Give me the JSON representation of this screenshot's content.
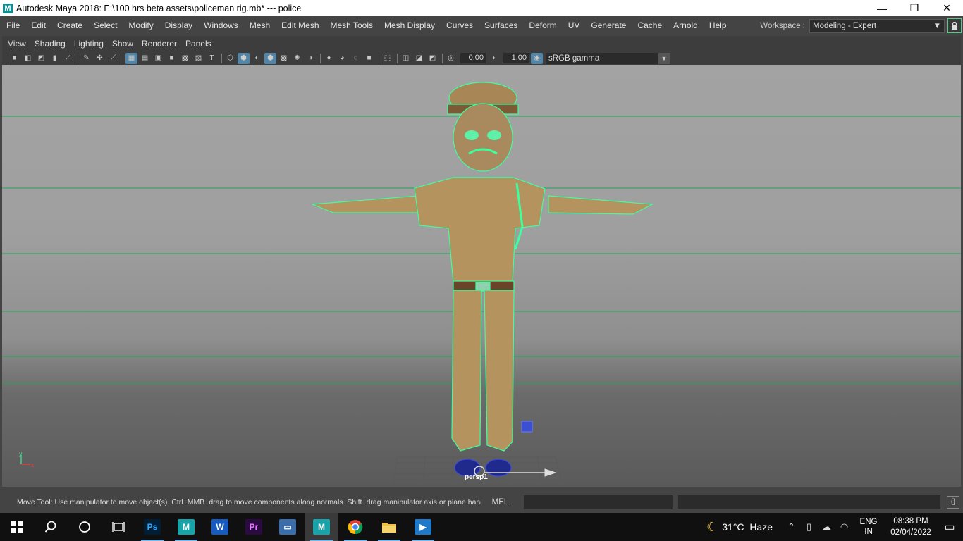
{
  "window": {
    "title": "Autodesk Maya 2018: E:\\100 hrs beta assets\\policeman rig.mb*  ---  police",
    "logo_letter": "M",
    "minimize": "—",
    "maximize": "❐",
    "close": "✕"
  },
  "menubar": {
    "items": [
      "File",
      "Edit",
      "Create",
      "Select",
      "Modify",
      "Display",
      "Windows",
      "Mesh",
      "Edit Mesh",
      "Mesh Tools",
      "Mesh Display",
      "Curves",
      "Surfaces",
      "Deform",
      "UV",
      "Generate",
      "Cache",
      "Arnold",
      "Help"
    ],
    "workspace_label": "Workspace :",
    "workspace_value": "Modeling - Expert",
    "lock_icon": "lock-icon"
  },
  "panel": {
    "menu": [
      "View",
      "Shading",
      "Lighting",
      "Show",
      "Renderer",
      "Panels"
    ],
    "exposure": "0.00",
    "gamma": "1.00",
    "color_space": "sRGB gamma"
  },
  "viewport": {
    "camera_label": "persp1",
    "axis_y": "y",
    "axis_x": "x",
    "wire_color": "#3dff9e",
    "mesh_color": "#b4935f"
  },
  "statusbar": {
    "help_line": "Move Tool: Use manipulator to move object(s). Ctrl+MMB+drag to move components along normals. Shift+drag manipulator axis or plane handles to",
    "mel_label": "MEL"
  },
  "taskbar": {
    "weather_temp": "31°C",
    "weather_desc": "Haze",
    "lang_top": "ENG",
    "lang_bottom": "IN",
    "time": "08:38 PM",
    "date": "02/04/2022",
    "apps": [
      {
        "name": "photoshop",
        "letter": "Ps",
        "color": "#001e36",
        "fg": "#31a8ff"
      },
      {
        "name": "maya-2018",
        "letter": "M",
        "color": "#18a3a9",
        "fg": "#ffffff"
      },
      {
        "name": "word",
        "letter": "W",
        "color": "#185abd",
        "fg": "#ffffff"
      },
      {
        "name": "premiere",
        "letter": "Pr",
        "color": "#2a0a40",
        "fg": "#ea77ff"
      },
      {
        "name": "monitor",
        "letter": "▭",
        "color": "#3b6ea8",
        "fg": "#ffffff"
      },
      {
        "name": "maya",
        "letter": "M",
        "color": "#18a3a9",
        "fg": "#ffffff"
      },
      {
        "name": "chrome",
        "letter": "●",
        "color": "#db4437",
        "fg": "#fbbc05"
      },
      {
        "name": "file-explorer",
        "letter": "▬",
        "color": "#f0c040",
        "fg": "#8a6a10"
      },
      {
        "name": "media-player",
        "letter": "▶",
        "color": "#1f78c8",
        "fg": "#ffffff"
      }
    ]
  }
}
